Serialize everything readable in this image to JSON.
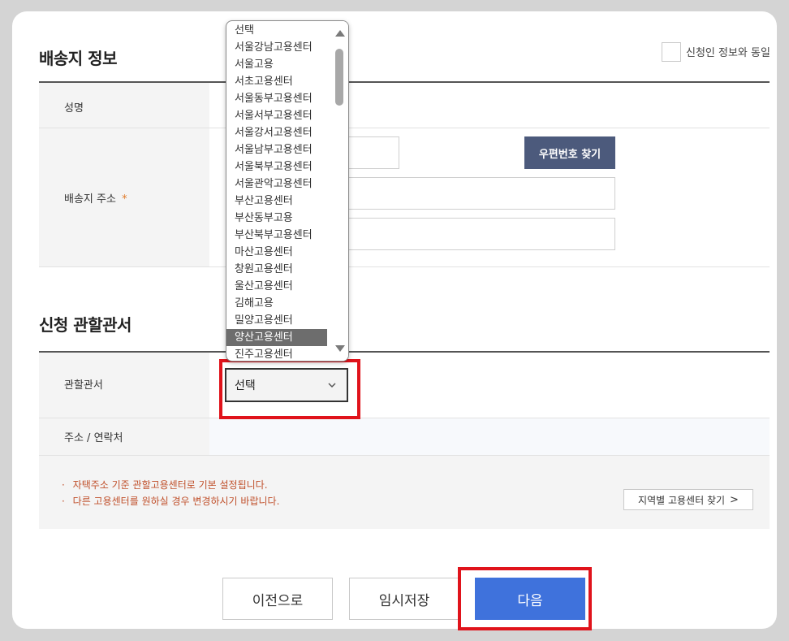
{
  "delivery_section": {
    "title": "배송지 정보",
    "same_as_applicant_label": "신청인 정보와 동일",
    "name_label": "성명",
    "address_label": "배송지 주소",
    "required_mark": "*",
    "zipcode_button": "우편번호 찾기"
  },
  "office_section": {
    "title": "신청 관할관서",
    "office_label": "관할관서",
    "select_value": "선택",
    "address_contact_label": "주소 / 연락처",
    "notes": [
      "자택주소 기준 관할고용센터로 기본 설정됩니다.",
      "다른 고용센터를 원하실 경우 변경하시기 바랍니다."
    ],
    "note_bullet": "·",
    "region_search_button": "지역별 고용센터 찾기",
    "region_search_chevron": ">"
  },
  "dropdown": {
    "options": [
      "선택",
      "서울강남고용센터",
      "서울고용",
      "서초고용센터",
      "서울동부고용센터",
      "서울서부고용센터",
      "서울강서고용센터",
      "서울남부고용센터",
      "서울북부고용센터",
      "서울관악고용센터",
      "부산고용센터",
      "부산동부고용",
      "부산북부고용센터",
      "마산고용센터",
      "창원고용센터",
      "울산고용센터",
      "김해고용",
      "밀양고용센터",
      "양산고용센터",
      "진주고용센터"
    ],
    "highlighted_option": "양산고용센터"
  },
  "footer": {
    "prev_button": "이전으로",
    "save_button": "임시저장",
    "next_button": "다음"
  },
  "colors": {
    "accent_blue": "#3f72dc",
    "navy_button": "#4c5a7c",
    "note_text": "#c0502b",
    "highlight_frame": "#e0131b",
    "required_mark": "#e07b2a"
  },
  "icons": {
    "chevron_down": "chevron-down-icon",
    "chevron_right": "chevron-right-icon",
    "scroll_up": "scroll-up-arrow-icon",
    "scroll_down": "scroll-down-arrow-icon"
  }
}
